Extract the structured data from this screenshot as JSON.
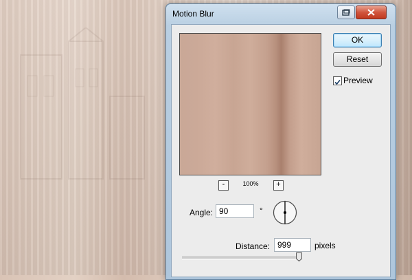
{
  "window": {
    "title": "Motion Blur"
  },
  "buttons": {
    "ok": "OK",
    "reset": "Reset"
  },
  "preview_option": {
    "label": "Preview",
    "checked": true
  },
  "zoom": {
    "level": "100%",
    "minus": "-",
    "plus": "+"
  },
  "angle": {
    "label": "Angle:",
    "value": "90",
    "unit": "°"
  },
  "distance": {
    "label": "Distance:",
    "value": "999",
    "unit": "pixels",
    "slider_fraction": 0.999
  },
  "colors": {
    "accent": "#3c7fb1",
    "close": "#c1391f"
  }
}
